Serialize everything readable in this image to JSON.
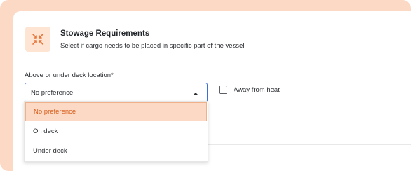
{
  "stowage": {
    "title": "Stowage Requirements",
    "subtitle": "Select if cargo needs to be placed in specific part of the vessel",
    "icon": "collapse-arrows-icon",
    "accent_color": "#e8763a"
  },
  "deck_location": {
    "label": "Above or under deck location*",
    "selected_value": "No preference",
    "options": [
      {
        "label": "No preference",
        "selected": true
      },
      {
        "label": "On deck",
        "selected": false
      },
      {
        "label": "Under deck",
        "selected": false
      }
    ]
  },
  "heat": {
    "label": "Away from heat",
    "checked": false
  },
  "colors": {
    "frame": "#fbd9c4",
    "focus_border": "#3b6fd4",
    "selected_option_bg": "#fbd9c4",
    "selected_option_text": "#d9601f"
  }
}
